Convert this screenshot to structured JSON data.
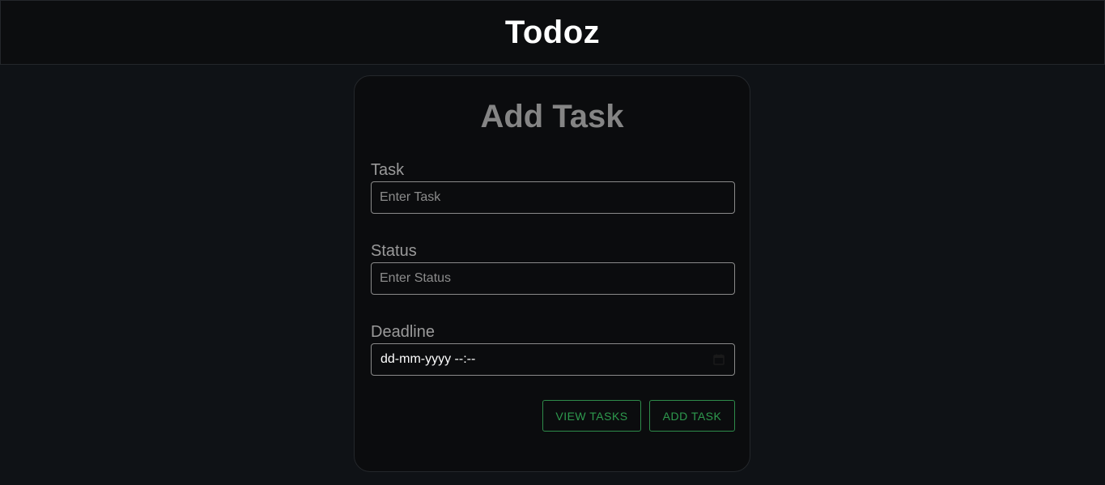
{
  "header": {
    "title": "Todoz"
  },
  "form": {
    "title": "Add Task",
    "task": {
      "label": "Task",
      "placeholder": "Enter Task",
      "value": ""
    },
    "status": {
      "label": "Status",
      "placeholder": "Enter Status",
      "value": ""
    },
    "deadline": {
      "label": "Deadline",
      "display": "dd-mm-yyyy --:--",
      "icon": "calendar-icon"
    },
    "buttons": {
      "view_tasks": "VIEW TASKS",
      "add_task": "ADD TASK"
    }
  },
  "colors": {
    "background": "#0f1216",
    "header_bg": "#0c0d0f",
    "card_bg": "#0b0c0e",
    "accent_green": "#2e9a4e"
  }
}
